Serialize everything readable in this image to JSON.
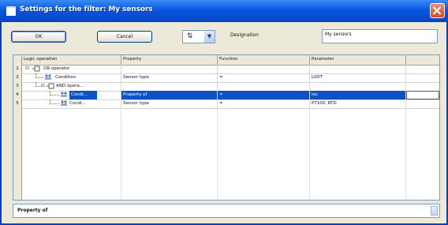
{
  "window": {
    "title": "Settings for the filter: My sensors"
  },
  "toolbar": {
    "ok_label": "OK",
    "cancel_label": "Cancel",
    "designation_label": "Designation",
    "designation_value": "My sensors"
  },
  "table": {
    "headers": [
      "Logic operation",
      "Property",
      "Function",
      "Parameter"
    ],
    "rows": [
      {
        "num": "1",
        "logic": "OR operator",
        "property": "",
        "function": "",
        "parameter": ""
      },
      {
        "num": "2",
        "logic": "Condition",
        "property": "Sensor type",
        "function": "=",
        "parameter": "LVDT"
      },
      {
        "num": "3",
        "logic": "AND opera...",
        "property": "",
        "function": "",
        "parameter": ""
      },
      {
        "num": "4",
        "logic": "Condi...",
        "property": "Property of",
        "function": "=",
        "parameter": "lec"
      },
      {
        "num": "5",
        "logic": "Condi...",
        "property": "Sensor type",
        "function": "=",
        "parameter": "PT100, RTD"
      }
    ]
  },
  "status": {
    "label": "Property of"
  }
}
